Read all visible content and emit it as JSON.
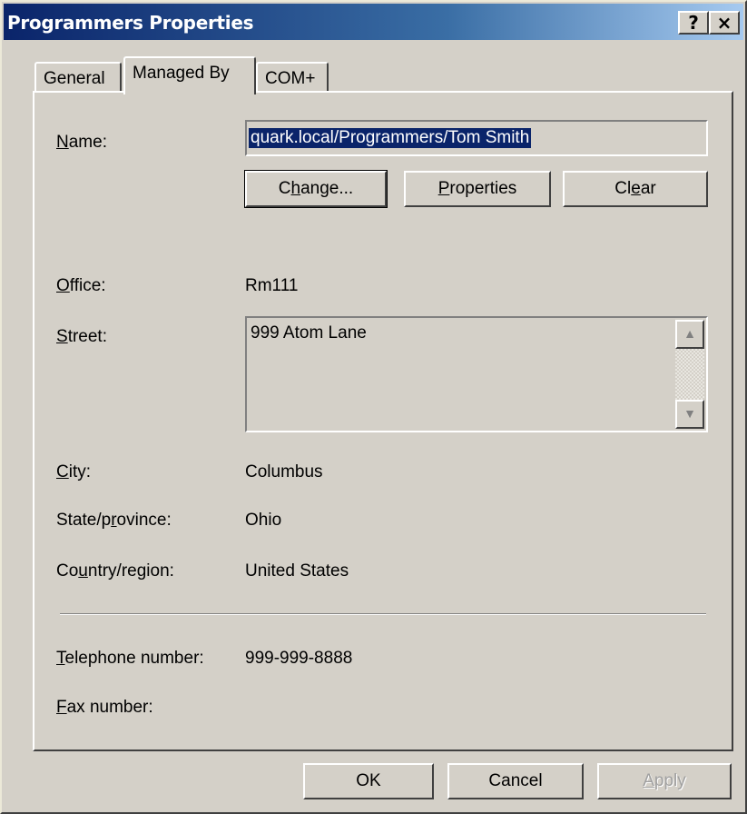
{
  "window": {
    "title": "Programmers Properties"
  },
  "caption_buttons": {
    "help": "?",
    "close": "×"
  },
  "tabs": [
    {
      "label": "General"
    },
    {
      "label": "Managed By"
    },
    {
      "label": "COM+"
    }
  ],
  "managed_by": {
    "name_label_u": "N",
    "name_label_rest": "ame:",
    "name_value": "quark.local/Programmers/Tom Smith",
    "change_u_pre": "C",
    "change_u": "h",
    "change_rest": "ange...",
    "properties_u": "P",
    "properties_rest": "roperties",
    "clear_pre": "Cl",
    "clear_u": "e",
    "clear_rest": "ar",
    "office_label_u": "O",
    "office_label_rest": "ffice:",
    "office_value": "Rm111",
    "street_label_u": "S",
    "street_label_rest": "treet:",
    "street_value": "999 Atom Lane",
    "city_label_u": "C",
    "city_label_rest": "ity:",
    "city_value": "Columbus",
    "state_label_pre": "State/p",
    "state_label_u": "r",
    "state_label_rest": "ovince:",
    "state_value": "Ohio",
    "country_label_pre": "Co",
    "country_label_u": "u",
    "country_label_rest": "ntry/region:",
    "country_value": "United States",
    "telephone_label_u": "T",
    "telephone_label_rest": "elephone number:",
    "telephone_value": "999-999-8888",
    "fax_label_u": "F",
    "fax_label_rest": "ax number:",
    "fax_value": ""
  },
  "footer": {
    "ok": "OK",
    "cancel": "Cancel",
    "apply_u": "A",
    "apply_rest": "pply"
  }
}
